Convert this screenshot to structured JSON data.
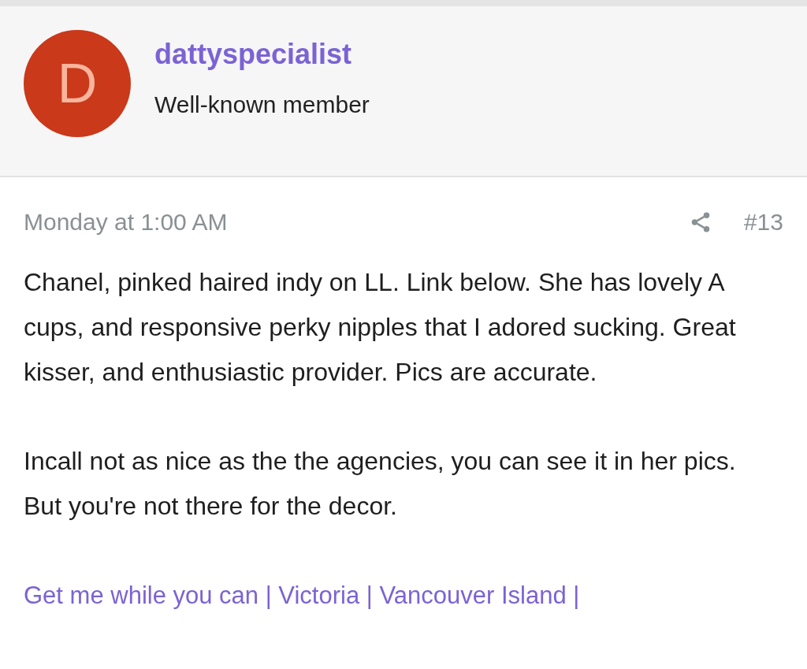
{
  "author": {
    "avatar_letter": "D",
    "username": "dattyspecialist",
    "role": "Well-known member"
  },
  "post": {
    "date": "Monday at 1:00 AM",
    "number": "#13",
    "paragraphs": [
      "Chanel, pinked haired indy on LL. Link below. She has lovely A cups, and responsive perky nipples that I adored sucking. Great kisser, and enthusiastic provider. Pics are accurate.",
      "Incall not as nice as the the agencies, you can see it in her pics. But you're not there for the decor."
    ],
    "link": "Get me while you can | Victoria | Vancouver Island |"
  }
}
